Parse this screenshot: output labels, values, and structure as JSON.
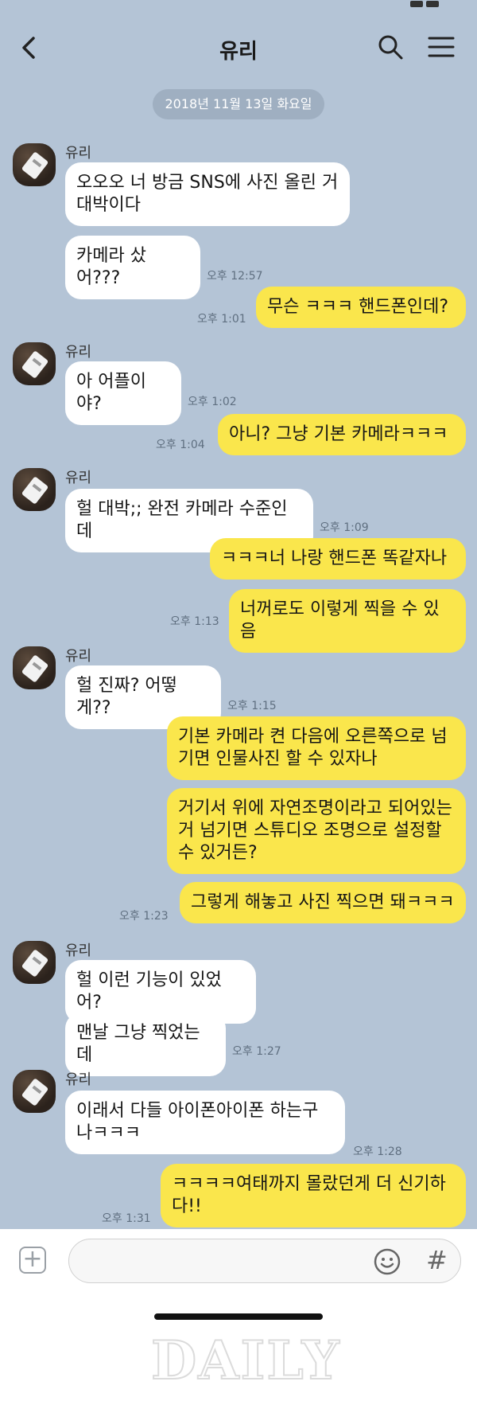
{
  "header": {
    "title": "유리"
  },
  "date_divider": "2018년 11월 13일 화요일",
  "sender_name": "유리",
  "messages": [
    {
      "text": "오오오 너 방금 SNS에 사진 올린 거 대박이다"
    },
    {
      "text": "카메라 샀어???",
      "time": "오후 12:57"
    },
    {
      "text": "무슨 ㅋㅋㅋ 핸드폰인데?",
      "time": "오후 1:01"
    },
    {
      "text": "아 어플이야?",
      "time": "오후 1:02"
    },
    {
      "text": "아니? 그냥 기본 카메라ㅋㅋㅋ",
      "time": "오후 1:04"
    },
    {
      "text": "헐 대박;; 완전 카메라 수준인데",
      "time": "오후 1:09"
    },
    {
      "text": "ㅋㅋㅋ너 나랑 핸드폰 똑같자나"
    },
    {
      "text": "너꺼로도 이렇게 찍을 수 있음",
      "time": "오후 1:13"
    },
    {
      "text": "헐 진짜? 어떻게??",
      "time": "오후 1:15"
    },
    {
      "text": "기본 카메라 켠 다음에 오른쪽으로 넘기면 인물사진 할 수 있자나"
    },
    {
      "text": "거기서 위에 자연조명이라고 되어있는 거 넘기면 스튜디오 조명으로 설정할 수 있거든?"
    },
    {
      "text": "그렇게 해놓고 사진 찍으면 돼ㅋㅋㅋ",
      "time": "오후 1:23"
    },
    {
      "text": "헐 이런 기능이 있었어?"
    },
    {
      "text": "맨날 그냥 찍었는데",
      "time": "오후 1:27"
    },
    {
      "text": "이래서 다들 아이폰아이폰 하는구나ㅋㅋㅋ",
      "time": "오후 1:28"
    },
    {
      "text": "ㅋㅋㅋㅋ여태까지 몰랐던게 더 신기하다!!",
      "time": "오후 1:31"
    }
  ],
  "input": {
    "placeholder": ""
  },
  "icons": {
    "back": "chevron-left-icon",
    "search": "search-icon",
    "menu": "hamburger-menu-icon",
    "plus": "plus-square-icon",
    "emoji": "smiley-icon",
    "hash": "hash-icon"
  },
  "colors": {
    "background": "#b4c4d6",
    "incoming": "#ffffff",
    "outgoing": "#fae64c"
  },
  "watermark": "DAILY"
}
